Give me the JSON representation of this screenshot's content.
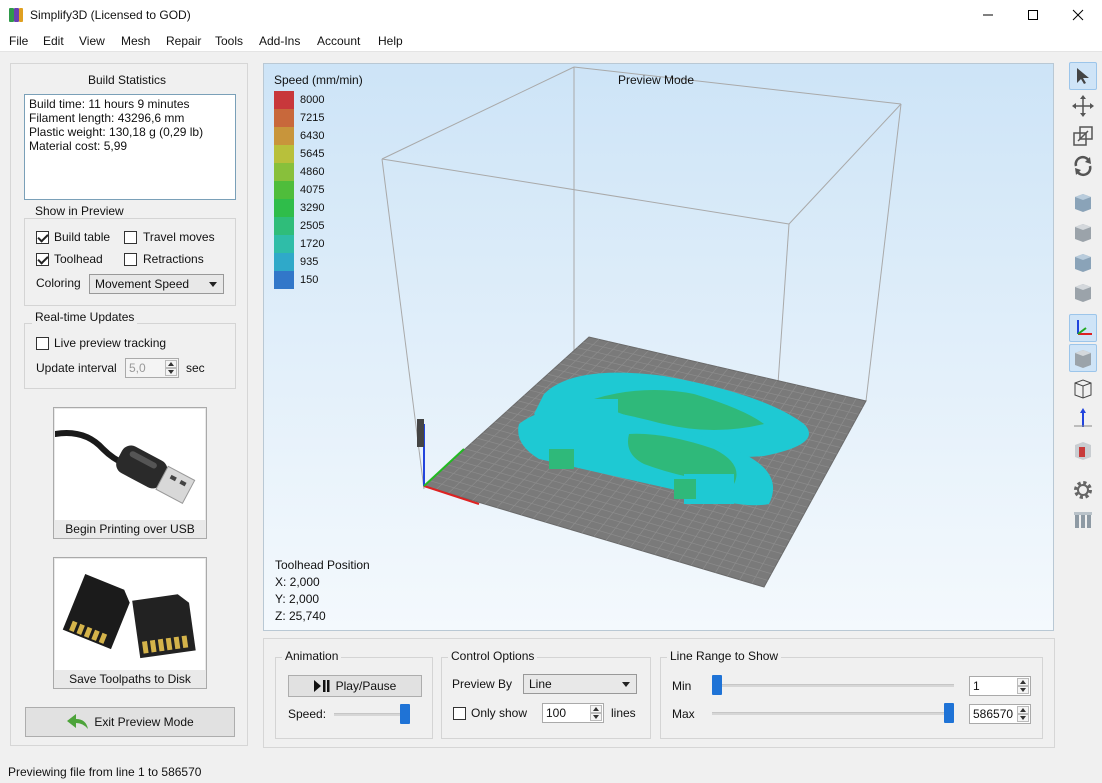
{
  "window": {
    "title": "Simplify3D (Licensed to GOD)"
  },
  "menu": [
    "File",
    "Edit",
    "View",
    "Mesh",
    "Repair",
    "Tools",
    "Add-Ins",
    "Account",
    "Help"
  ],
  "build_stats": {
    "title": "Build Statistics",
    "lines": [
      "Build time: 11 hours 9 minutes",
      "Filament length: 43296,6 mm",
      "Plastic weight: 130,18 g (0,29 lb)",
      "Material cost: 5,99"
    ]
  },
  "show_in_preview": {
    "title": "Show in Preview",
    "build_table": {
      "label": "Build table",
      "checked": true
    },
    "travel_moves": {
      "label": "Travel moves",
      "checked": false
    },
    "toolhead": {
      "label": "Toolhead",
      "checked": true
    },
    "retractions": {
      "label": "Retractions",
      "checked": false
    },
    "coloring_label": "Coloring",
    "coloring_value": "Movement Speed"
  },
  "realtime": {
    "title": "Real-time Updates",
    "live_label": "Live preview tracking",
    "live_checked": false,
    "interval_label": "Update interval",
    "interval_value": "5,0",
    "interval_unit": "sec"
  },
  "usb_button": "Begin Printing over USB",
  "disk_button": "Save Toolpaths to Disk",
  "exit_button": "Exit Preview Mode",
  "viewport": {
    "legend_title": "Speed (mm/min)",
    "mode_label": "Preview Mode",
    "legend": [
      {
        "value": "8000",
        "color": "#c8373b"
      },
      {
        "value": "7215",
        "color": "#c8683b"
      },
      {
        "value": "6430",
        "color": "#c8953b"
      },
      {
        "value": "5645",
        "color": "#b8c03b"
      },
      {
        "value": "4860",
        "color": "#88c03b"
      },
      {
        "value": "4075",
        "color": "#4fbd3b"
      },
      {
        "value": "3290",
        "color": "#2fbd4a"
      },
      {
        "value": "2505",
        "color": "#2fbd7a"
      },
      {
        "value": "1720",
        "color": "#2fbda8"
      },
      {
        "value": "935",
        "color": "#2fa9c9"
      },
      {
        "value": "150",
        "color": "#3277c9"
      }
    ],
    "toolhead_title": "Toolhead Position",
    "x": "X: 2,000",
    "y": "Y: 2,000",
    "z": "Z: 25,740"
  },
  "animation": {
    "title": "Animation",
    "play_label": "Play/Pause",
    "speed_label": "Speed:",
    "speed_level": 0.95
  },
  "control": {
    "title": "Control Options",
    "preview_by_label": "Preview By",
    "preview_by_value": "Line",
    "only_show_label": "Only show",
    "only_show_checked": false,
    "only_show_value": "100",
    "only_show_unit": "lines"
  },
  "line_range": {
    "title": "Line Range to Show",
    "min_label": "Min",
    "max_label": "Max",
    "min_value": "1",
    "max_value": "586570"
  },
  "status": "Previewing file from line 1 to 586570",
  "colors": {
    "accent": "#1f73d6",
    "model": "#22c8d4",
    "model_fast": "#2fbd7a"
  }
}
